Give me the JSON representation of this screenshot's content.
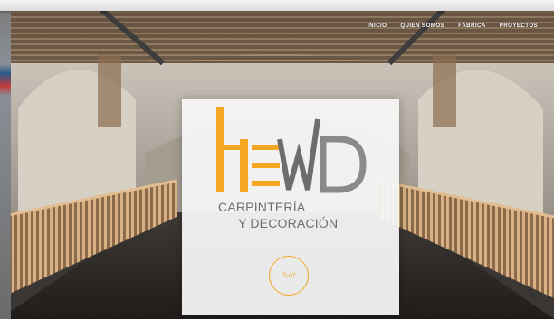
{
  "nav": {
    "items": [
      "INICIO",
      "QUIEN SOMOS",
      "FÁBRICA",
      "PROYECTOS"
    ]
  },
  "hero": {
    "logo_letters": "HEWD",
    "tagline_line1": "CARPINTERÍA",
    "tagline_line2": "Y DECORACIÓN",
    "play_label": "PLAY"
  },
  "colors": {
    "accent_orange": "#f5a623",
    "logo_gray": "#6d6d6d",
    "card_bg": "#f6f6f6"
  }
}
